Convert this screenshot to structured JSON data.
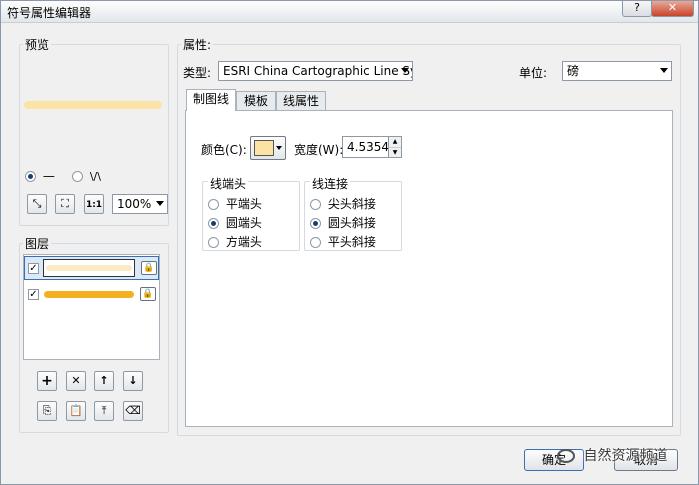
{
  "window": {
    "title": "符号属性编辑器",
    "help_glyph": "?",
    "close_glyph": "✕"
  },
  "preview": {
    "label": "预览",
    "line_color": "#fbe3a6",
    "mode_line_glyph": "—",
    "mode_wave_glyph": "\\/\\",
    "zoom": "100%"
  },
  "layers": {
    "label": "图层",
    "items": [
      {
        "checked": true,
        "color": "#fbeac3"
      },
      {
        "checked": true,
        "color": "#f4b020"
      }
    ]
  },
  "properties": {
    "label": "属性:",
    "type_label": "类型:",
    "type_value": "ESRI China Cartographic Line Symbol",
    "unit_label": "单位:",
    "unit_value": "磅"
  },
  "tabs": [
    {
      "label": "制图线"
    },
    {
      "label": "模板"
    },
    {
      "label": "线属性"
    }
  ],
  "cartographic": {
    "color_label": "颜色(C):",
    "color_value": "#fbe3a6",
    "width_label": "宽度(W):",
    "width_value": "4.5354",
    "cap": {
      "title": "线端头",
      "options": [
        "平端头",
        "圆端头",
        "方端头"
      ],
      "selected_index": 1
    },
    "join": {
      "title": "线连接",
      "options": [
        "尖头斜接",
        "圆头斜接",
        "平头斜接"
      ],
      "selected_index": 1
    }
  },
  "footer": {
    "ok_label": "确定",
    "cancel_label": "取消",
    "watermark": "自然资源频道"
  }
}
